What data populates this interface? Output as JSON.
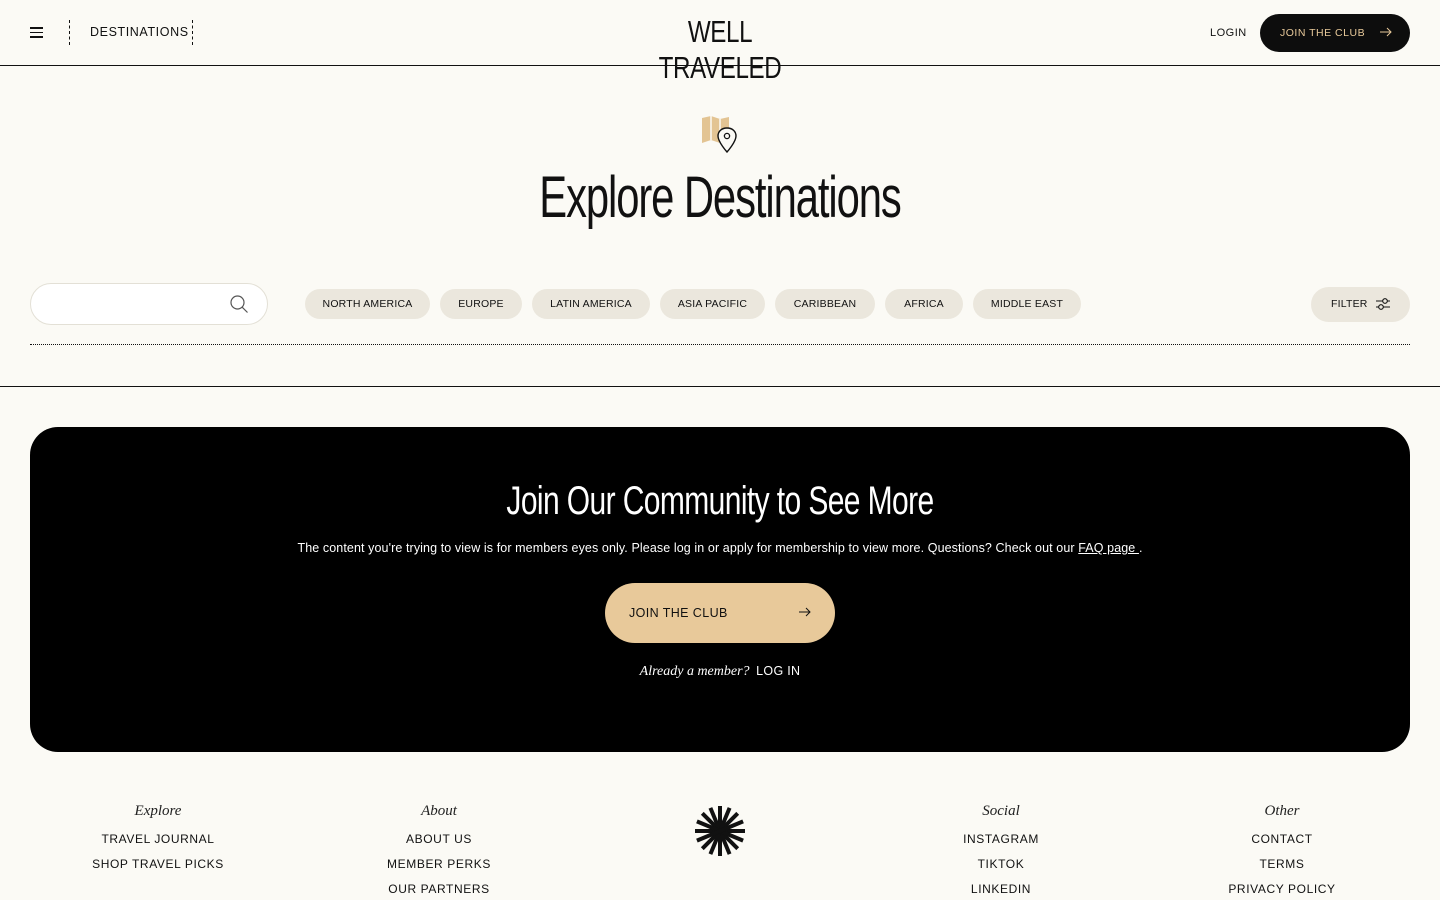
{
  "header": {
    "nav_label": "DESTINATIONS",
    "logo": "WELL TRAVELED",
    "login_label": "LOGIN",
    "join_label": "JOIN THE CLUB"
  },
  "hero": {
    "title": "Explore Destinations"
  },
  "search": {
    "placeholder": "",
    "value": ""
  },
  "regions": [
    "NORTH AMERICA",
    "EUROPE",
    "LATIN AMERICA",
    "ASIA PACIFIC",
    "CARIBBEAN",
    "AFRICA",
    "MIDDLE EAST"
  ],
  "filter_label": "FILTER",
  "gate": {
    "title": "Join Our Community to See More",
    "text": "The content you're trying to view is for members eyes only. Please log in or apply for membership to view more. Questions? Check out our",
    "faq_link": "FAQ page ",
    "text_end": ".",
    "join_label": "JOIN THE CLUB",
    "member_prompt": "Already a member?",
    "login_label": "LOG IN"
  },
  "footer": {
    "explore": {
      "heading": "Explore",
      "items": [
        "TRAVEL JOURNAL",
        "SHOP TRAVEL PICKS"
      ]
    },
    "about": {
      "heading": "About",
      "items": [
        "ABOUT US",
        "MEMBER PERKS",
        "OUR PARTNERS"
      ]
    },
    "social": {
      "heading": "Social",
      "items": [
        "INSTAGRAM",
        "TIKTOK",
        "LINKEDIN"
      ]
    },
    "other": {
      "heading": "Other",
      "items": [
        "CONTACT",
        "TERMS",
        "PRIVACY POLICY"
      ]
    }
  },
  "colors": {
    "background": "#fbfaf5",
    "accent": "#e8c99a",
    "pill": "#ebe7dd",
    "dark": "#000000"
  }
}
